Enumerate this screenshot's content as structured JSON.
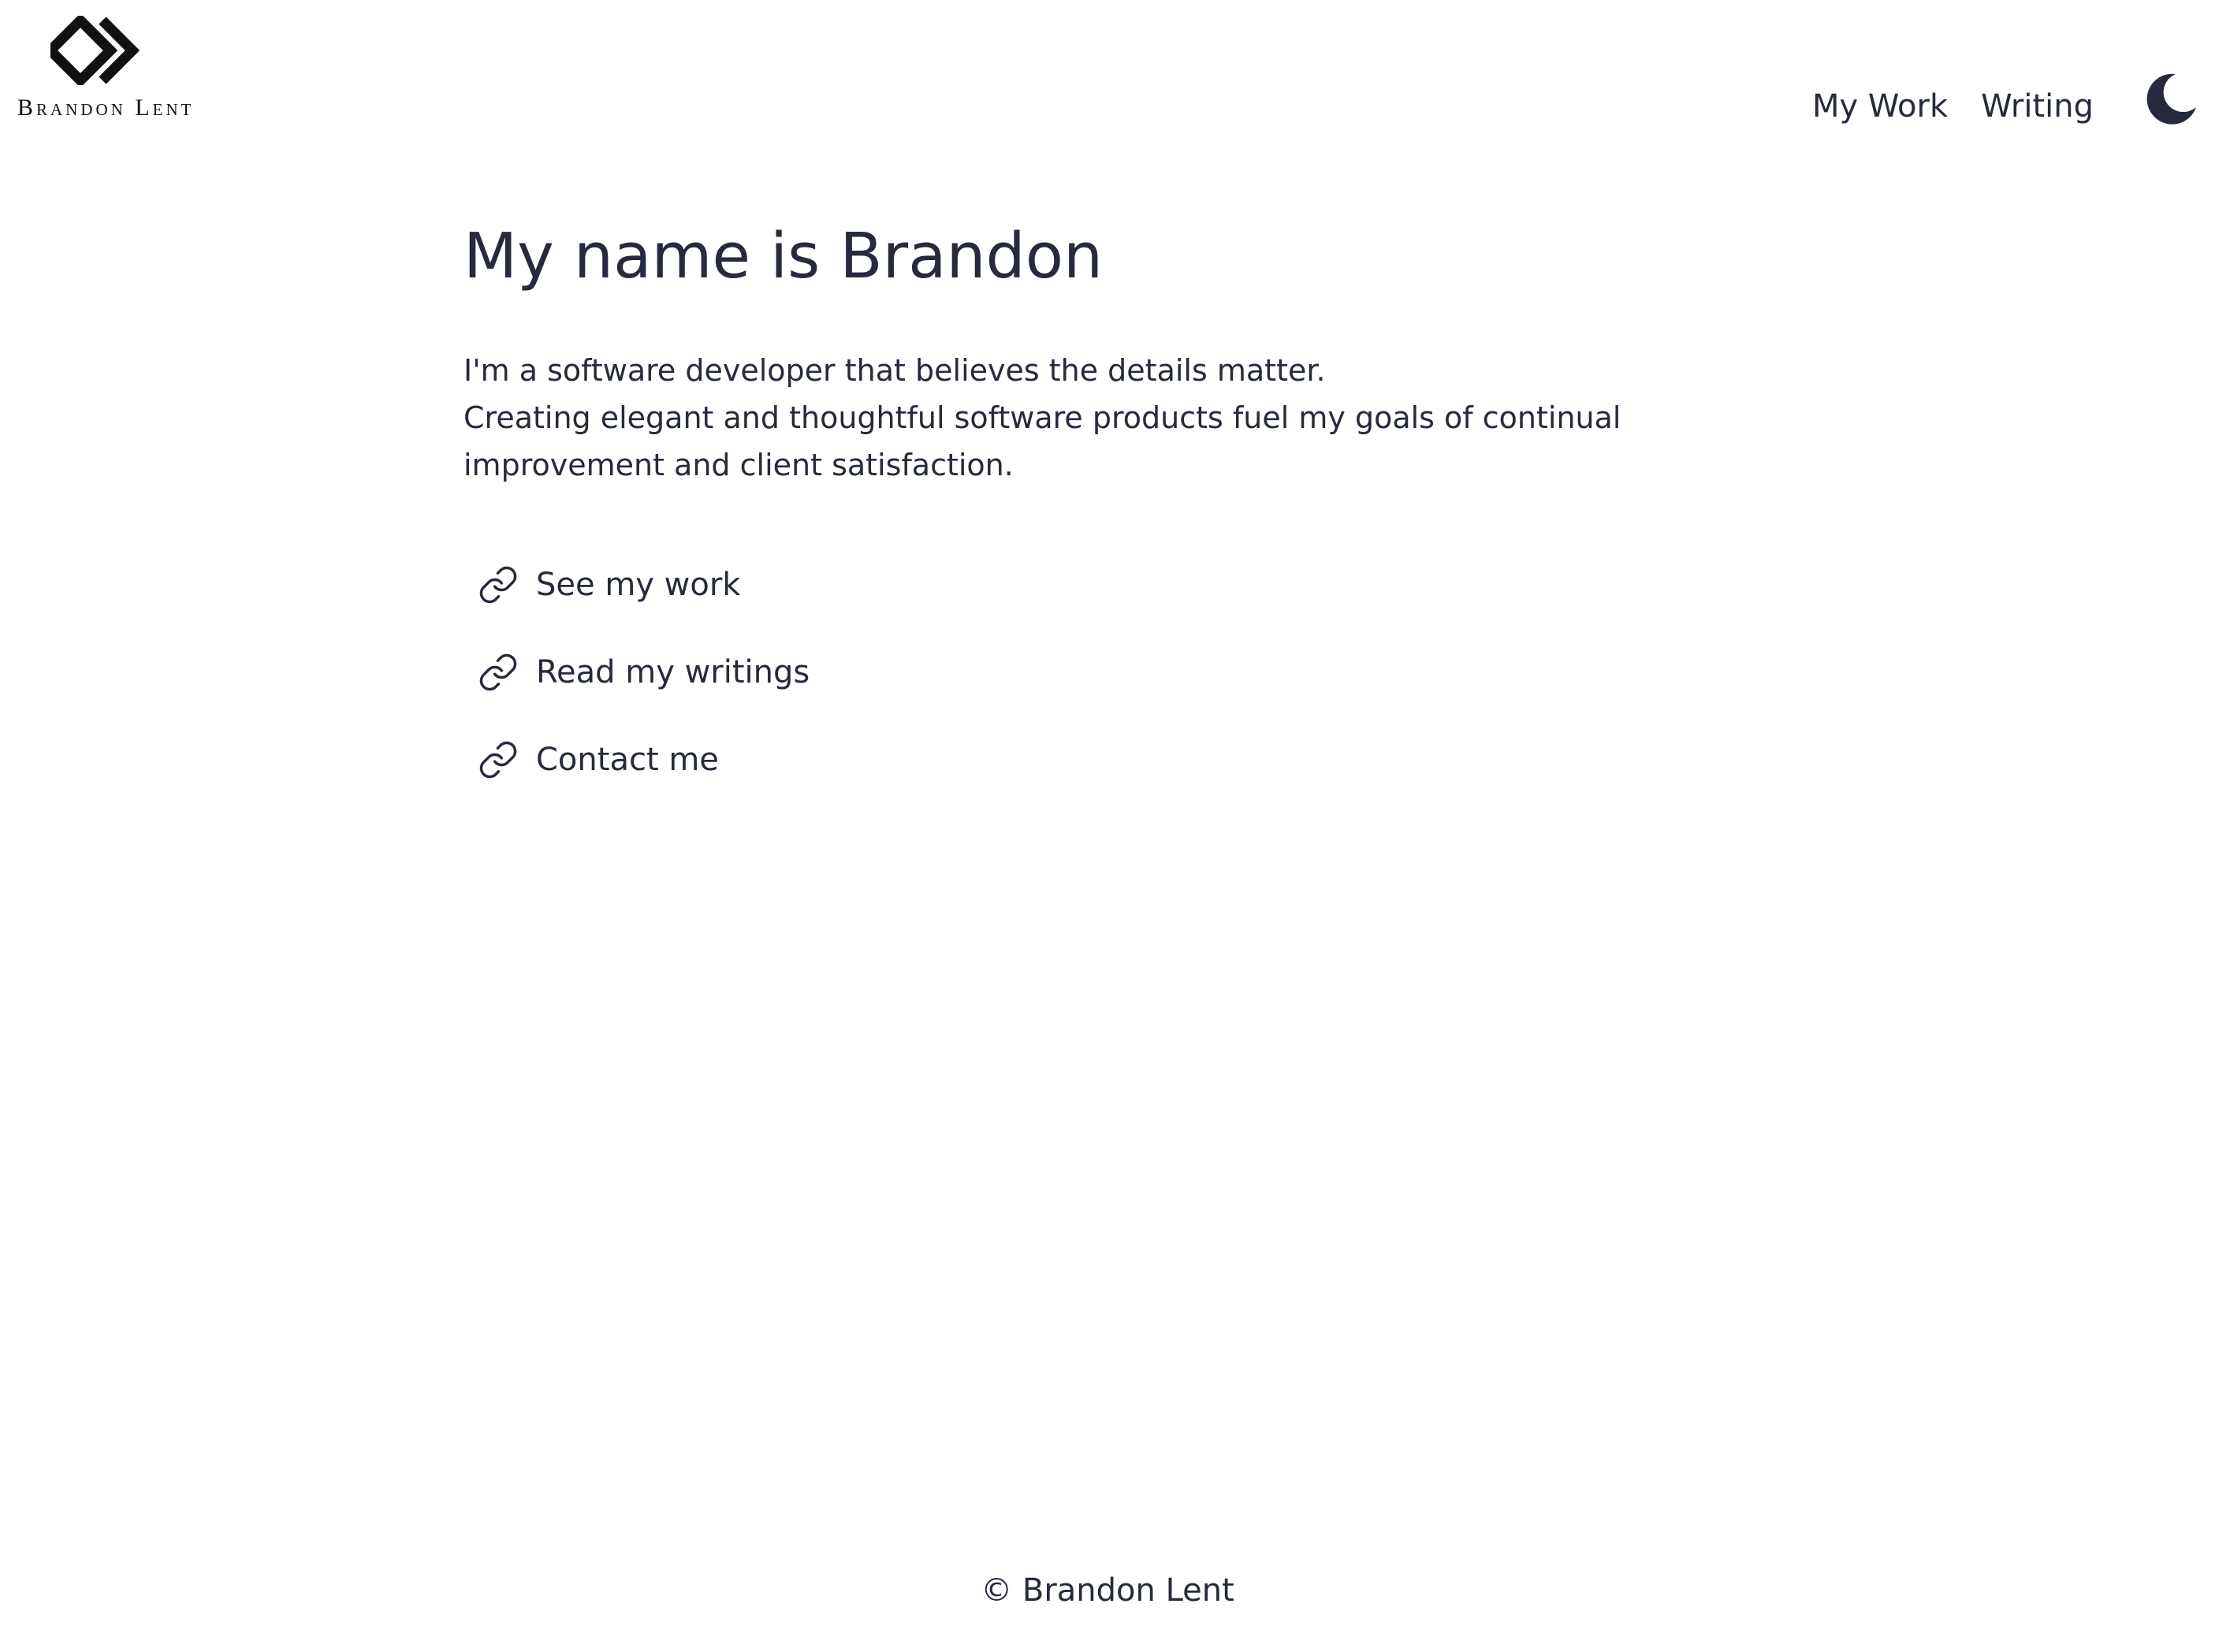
{
  "header": {
    "logo_text": "Brandon Lent",
    "logo_icon": "chevron-diamond-logo",
    "nav": [
      {
        "label": "My Work"
      },
      {
        "label": "Writing"
      }
    ],
    "theme_toggle_icon": "moon-icon"
  },
  "main": {
    "title": "My name is Brandon",
    "intro": [
      "I'm a software developer that believes the details matter.",
      "Creating elegant and thoughtful software products fuel my goals of continual",
      "improvement and client satisfaction."
    ],
    "links": [
      {
        "label": "See my work",
        "icon": "link-icon"
      },
      {
        "label": "Read my writings",
        "icon": "link-icon"
      },
      {
        "label": "Contact me",
        "icon": "link-icon"
      }
    ]
  },
  "footer": {
    "copyright": "© Brandon Lent"
  },
  "colors": {
    "text": "#262a3c",
    "logo": "#111111",
    "background": "#ffffff"
  }
}
